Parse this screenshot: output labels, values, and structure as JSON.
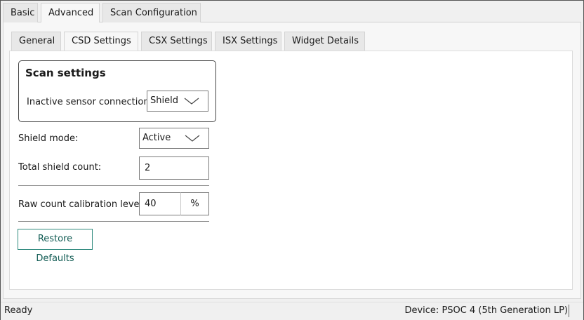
{
  "tabs": {
    "main": [
      {
        "label": "Basic",
        "active": false
      },
      {
        "label": "Advanced",
        "active": true
      },
      {
        "label": "Scan Configuration",
        "active": false
      }
    ],
    "sub": [
      {
        "label": "General",
        "active": false
      },
      {
        "label": "CSD Settings",
        "active": true
      },
      {
        "label": "CSX Settings",
        "active": false
      },
      {
        "label": "ISX Settings",
        "active": false
      },
      {
        "label": "Widget Details",
        "active": false
      }
    ]
  },
  "scan_settings": {
    "title": "Scan settings",
    "inactive_sensor_label": "Inactive sensor connection:",
    "inactive_sensor_value": "Shield"
  },
  "shield_mode": {
    "label": "Shield mode:",
    "value": "Active"
  },
  "total_shield_count": {
    "label": "Total shield count:",
    "value": "2"
  },
  "raw_count": {
    "label": "Raw count calibration level:",
    "value": "40",
    "unit": "%"
  },
  "restore_button": "Restore Defaults",
  "status": {
    "left": "Ready",
    "right": "Device: PSOC 4 (5th Generation LP)"
  },
  "icons": {
    "dropdown": "chevron-down-icon"
  },
  "colors": {
    "restore_border": "#2f8a7e",
    "restore_text": "#0f5a52"
  }
}
